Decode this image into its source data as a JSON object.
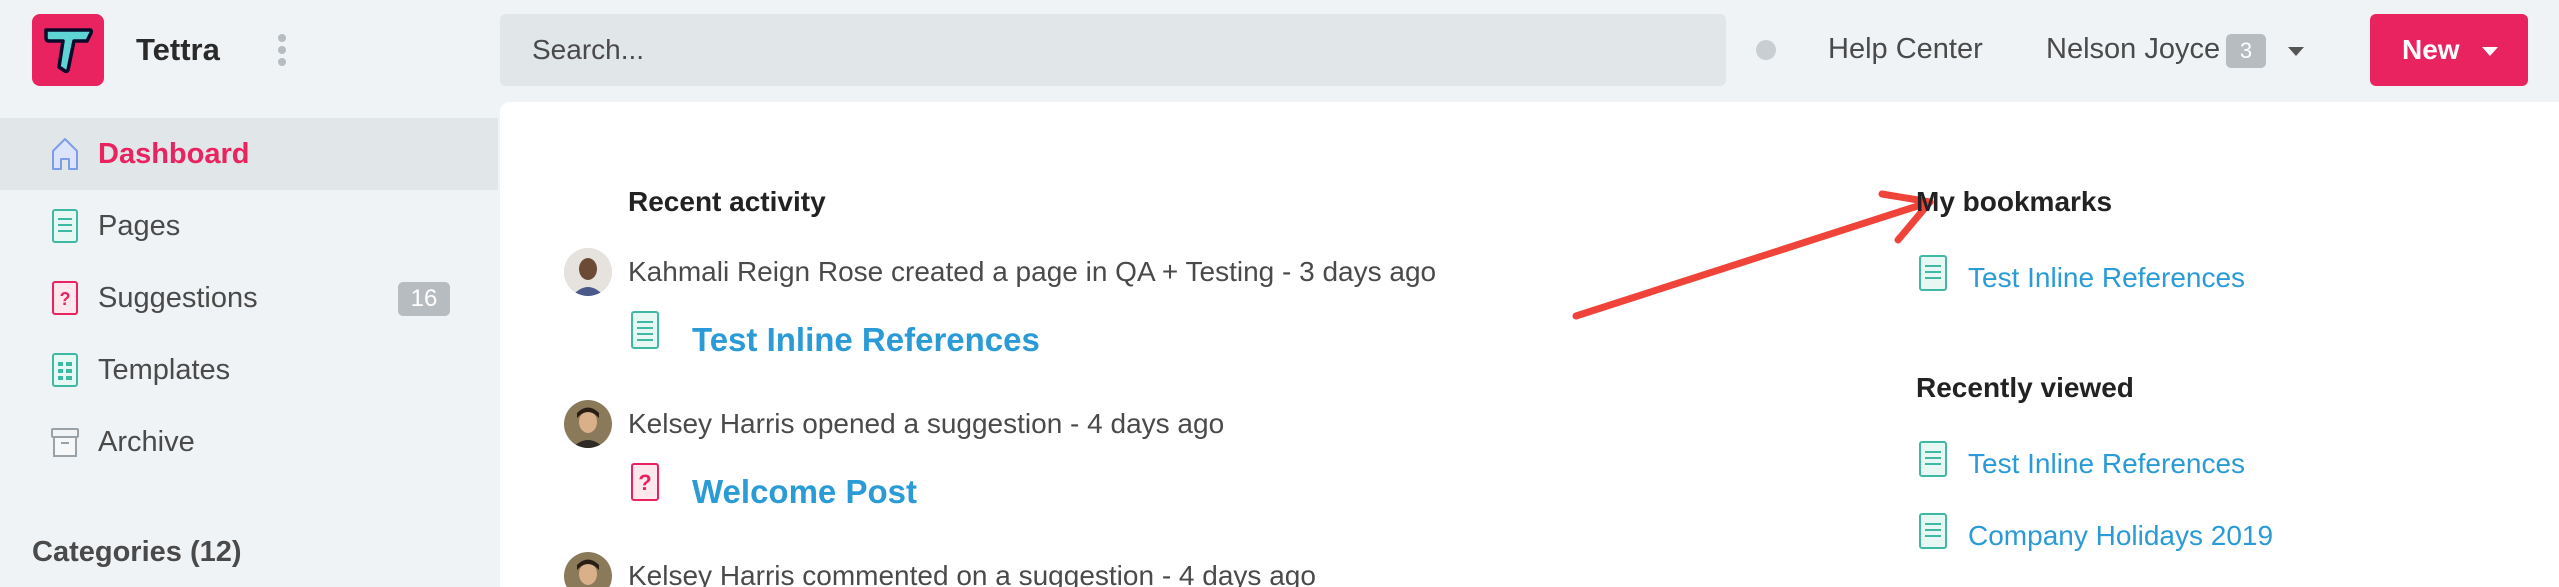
{
  "app": {
    "name": "Tettra"
  },
  "search": {
    "placeholder": "Search..."
  },
  "header": {
    "help_label": "Help Center",
    "user_name": "Nelson Joyce",
    "user_count": "3",
    "new_label": "New"
  },
  "sidebar": {
    "items": [
      {
        "label": "Dashboard",
        "icon": "home-icon",
        "active": true
      },
      {
        "label": "Pages",
        "icon": "page-icon"
      },
      {
        "label": "Suggestions",
        "icon": "question-icon",
        "count": "16"
      },
      {
        "label": "Templates",
        "icon": "template-icon"
      },
      {
        "label": "Archive",
        "icon": "archive-icon"
      }
    ],
    "categories_label": "Categories (12)"
  },
  "activity": {
    "title": "Recent activity",
    "items": [
      {
        "text": "Kahmali Reign Rose created a page in QA + Testing - 3 days ago",
        "link": "Test Inline References",
        "icon": "page-icon"
      },
      {
        "text": "Kelsey Harris opened a suggestion - 4 days ago",
        "link": "Welcome Post",
        "icon": "question-icon"
      },
      {
        "text": "Kelsey Harris commented on a suggestion - 4 days ago"
      }
    ]
  },
  "bookmarks": {
    "title": "My bookmarks",
    "items": [
      {
        "label": "Test Inline References"
      }
    ]
  },
  "recent": {
    "title": "Recently viewed",
    "items": [
      {
        "label": "Test Inline References"
      },
      {
        "label": "Company Holidays 2019"
      }
    ]
  },
  "colors": {
    "brand": "#e8235f",
    "link": "#2a9bd6",
    "annotation_arrow": "#f0443a",
    "page_icon": "#3fb8a4"
  }
}
